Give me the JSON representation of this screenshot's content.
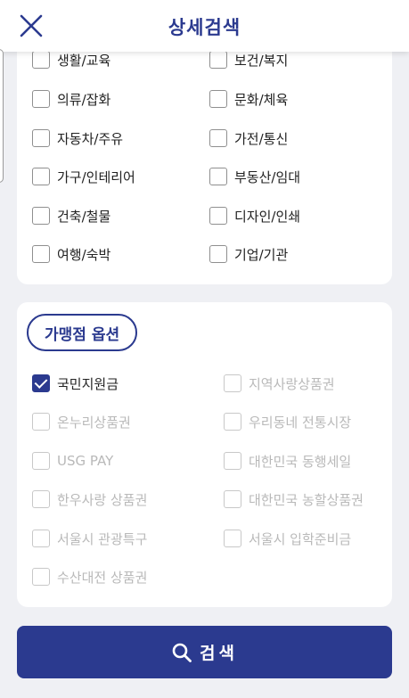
{
  "header": {
    "title": "상세검색"
  },
  "categories": [
    {
      "label": "생활/교육",
      "checked": false
    },
    {
      "label": "보건/복지",
      "checked": false
    },
    {
      "label": "의류/잡화",
      "checked": false
    },
    {
      "label": "문화/체육",
      "checked": false
    },
    {
      "label": "자동차/주유",
      "checked": false
    },
    {
      "label": "가전/통신",
      "checked": false
    },
    {
      "label": "가구/인테리어",
      "checked": false
    },
    {
      "label": "부동산/임대",
      "checked": false
    },
    {
      "label": "건축/철물",
      "checked": false
    },
    {
      "label": "디자인/인쇄",
      "checked": false
    },
    {
      "label": "여행/숙박",
      "checked": false
    },
    {
      "label": "기업/기관",
      "checked": false
    }
  ],
  "franchise": {
    "title": "가맹점 옵션",
    "options": [
      {
        "label": "국민지원금",
        "checked": true,
        "enabled": true
      },
      {
        "label": "지역사랑상품권",
        "checked": false,
        "enabled": false
      },
      {
        "label": "온누리상품권",
        "checked": false,
        "enabled": false
      },
      {
        "label": "우리동네 전통시장",
        "checked": false,
        "enabled": false
      },
      {
        "label": "USG PAY",
        "checked": false,
        "enabled": false
      },
      {
        "label": "대한민국 동행세일",
        "checked": false,
        "enabled": false
      },
      {
        "label": "한우사랑 상품권",
        "checked": false,
        "enabled": false
      },
      {
        "label": "대한민국 농할상품권",
        "checked": false,
        "enabled": false
      },
      {
        "label": "서울시 관광특구",
        "checked": false,
        "enabled": false
      },
      {
        "label": "서울시 입학준비금",
        "checked": false,
        "enabled": false
      },
      {
        "label": "수산대전 상품권",
        "checked": false,
        "enabled": false
      }
    ]
  },
  "search_button": {
    "label": "검색",
    "icon": "search-icon"
  },
  "colors": {
    "primary": "#2b3a8f",
    "background": "#eff0f4",
    "disabled": "#b9b9b9"
  }
}
